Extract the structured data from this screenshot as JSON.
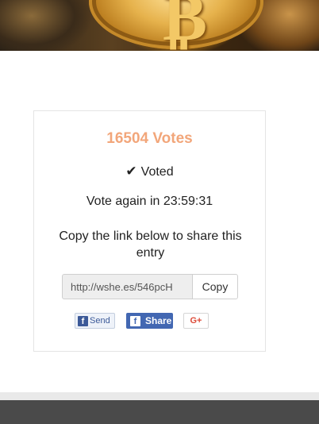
{
  "entry": {
    "votes": "16504 Votes",
    "voted_label": "Voted",
    "vote_again": "Vote again in 23:59:31",
    "share_prompt": "Copy the link below to share this entry",
    "share_link": "http://wshe.es/546pcH",
    "copy_label": "Copy"
  },
  "social": {
    "fb_send_label": "Send",
    "fb_share_label": "Share",
    "gplus_label": "G+"
  },
  "icons": {
    "check": "check-icon",
    "facebook": "facebook-icon"
  },
  "colors": {
    "votes": "#f2a67a",
    "facebook": "#4267b2",
    "gplus": "#dd4b39"
  }
}
